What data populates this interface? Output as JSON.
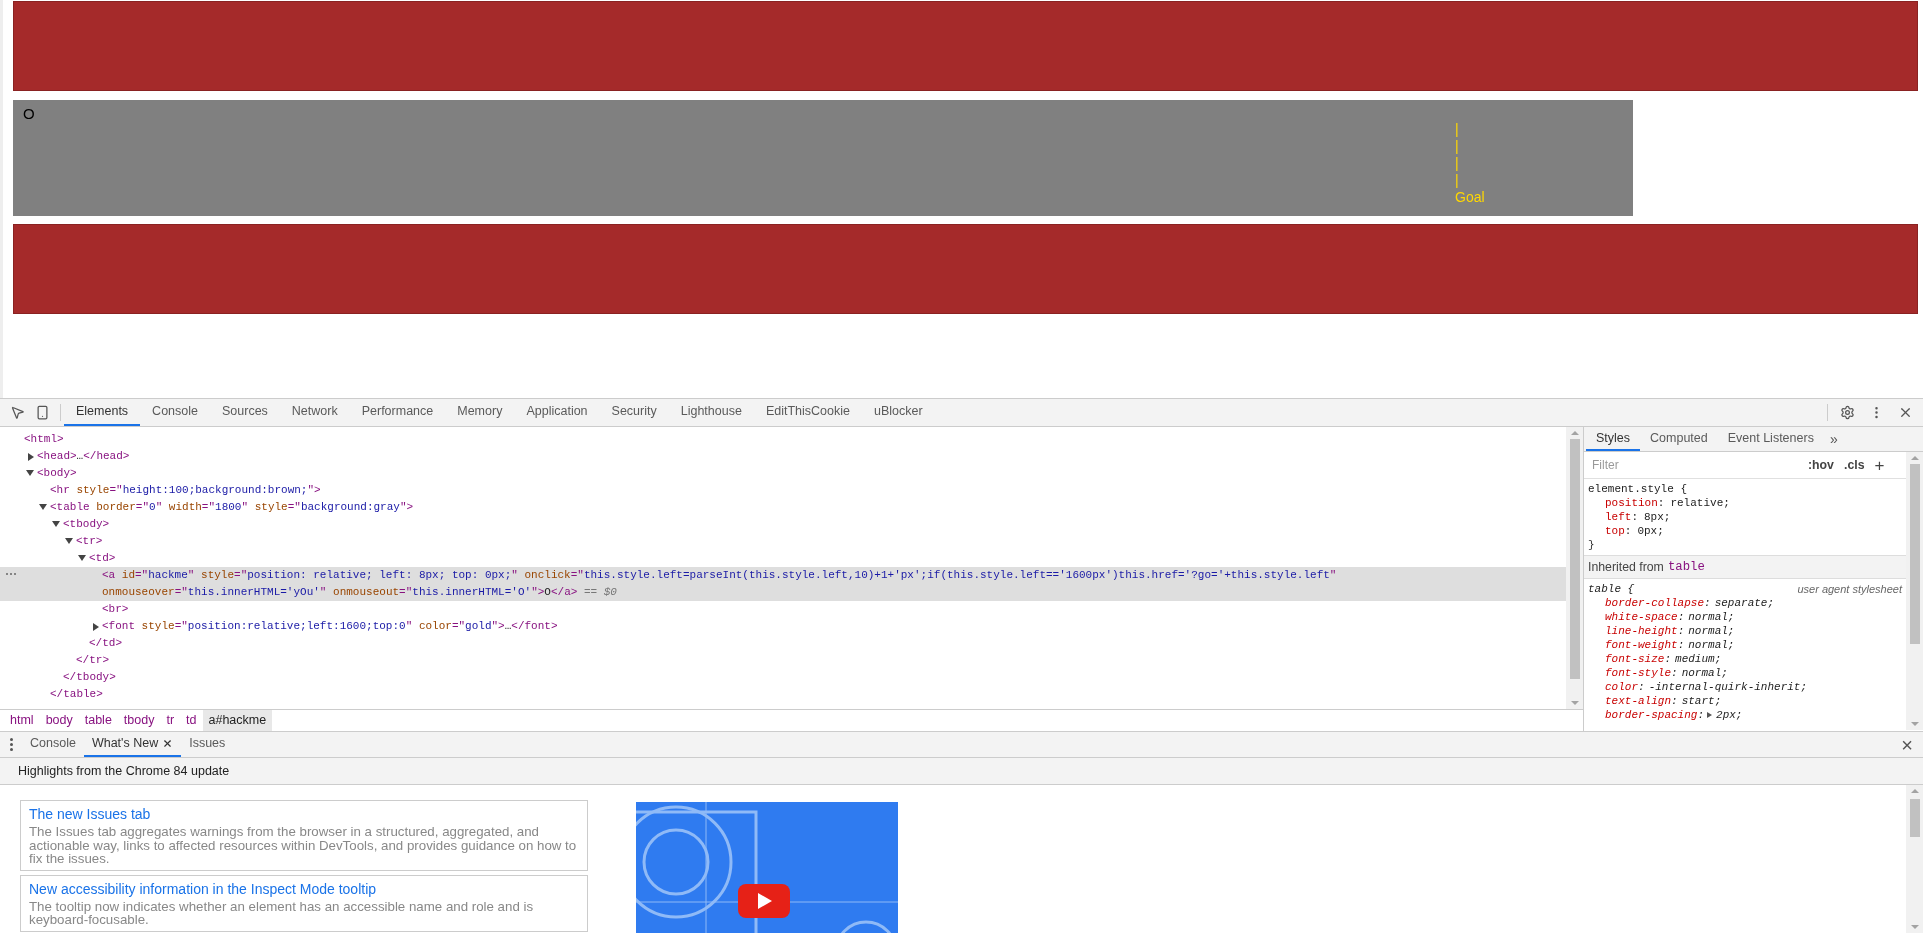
{
  "page": {
    "link_text": "O",
    "goal_lines": [
      "|",
      "|",
      "|",
      "|",
      "Goal"
    ]
  },
  "devtools": {
    "tabs": [
      {
        "label": "Elements",
        "selected": true
      },
      {
        "label": "Console",
        "selected": false
      },
      {
        "label": "Sources",
        "selected": false
      },
      {
        "label": "Network",
        "selected": false
      },
      {
        "label": "Performance",
        "selected": false
      },
      {
        "label": "Memory",
        "selected": false
      },
      {
        "label": "Application",
        "selected": false
      },
      {
        "label": "Security",
        "selected": false
      },
      {
        "label": "Lighthouse",
        "selected": false
      },
      {
        "label": "EditThisCookie",
        "selected": false
      },
      {
        "label": "uBlocker",
        "selected": false
      }
    ],
    "dom_tree": [
      {
        "selected": false,
        "tokens": [
          {
            "kind": "tag",
            "text": "<html>"
          }
        ],
        "children": [
          {
            "expanded": false,
            "selected": false,
            "tokens": [
              {
                "kind": "tag",
                "text": "<head>"
              },
              {
                "kind": "text",
                "text": "…"
              },
              {
                "kind": "tag",
                "text": "</head>"
              }
            ]
          },
          {
            "expanded": true,
            "selected": false,
            "tokens": [
              {
                "kind": "tag",
                "text": "<body>"
              }
            ],
            "children": [
              {
                "selected": false,
                "tokens": [
                  {
                    "kind": "tag",
                    "text": "<hr"
                  },
                  {
                    "kind": "attr",
                    "text": " style"
                  },
                  {
                    "kind": "tag",
                    "text": "=\""
                  },
                  {
                    "kind": "value",
                    "text": "height:100;background:brown;"
                  },
                  {
                    "kind": "tag",
                    "text": "\">"
                  }
                ]
              },
              {
                "expanded": true,
                "selected": false,
                "tokens": [
                  {
                    "kind": "tag",
                    "text": "<table"
                  },
                  {
                    "kind": "attr",
                    "text": " border"
                  },
                  {
                    "kind": "tag",
                    "text": "=\""
                  },
                  {
                    "kind": "value",
                    "text": "0"
                  },
                  {
                    "kind": "tag",
                    "text": "\""
                  },
                  {
                    "kind": "attr",
                    "text": " width"
                  },
                  {
                    "kind": "tag",
                    "text": "=\""
                  },
                  {
                    "kind": "value",
                    "text": "1800"
                  },
                  {
                    "kind": "tag",
                    "text": "\""
                  },
                  {
                    "kind": "attr",
                    "text": " style"
                  },
                  {
                    "kind": "tag",
                    "text": "=\""
                  },
                  {
                    "kind": "value",
                    "text": "background:gray"
                  },
                  {
                    "kind": "tag",
                    "text": "\">"
                  }
                ],
                "close": "</table>",
                "children": [
                  {
                    "expanded": true,
                    "selected": false,
                    "tokens": [
                      {
                        "kind": "tag",
                        "text": "<tbody>"
                      }
                    ],
                    "close": "</tbody>",
                    "children": [
                      {
                        "expanded": true,
                        "selected": false,
                        "tokens": [
                          {
                            "kind": "tag",
                            "text": "<tr>"
                          }
                        ],
                        "close": "</tr>",
                        "children": [
                          {
                            "expanded": true,
                            "selected": false,
                            "tokens": [
                              {
                                "kind": "tag",
                                "text": "<td>"
                              }
                            ],
                            "close": "</td>",
                            "children": [
                              {
                                "selected": true,
                                "tokens": [
                                  {
                                    "kind": "tag",
                                    "text": "<a"
                                  },
                                  {
                                    "kind": "attr",
                                    "text": " id"
                                  },
                                  {
                                    "kind": "tag",
                                    "text": "=\""
                                  },
                                  {
                                    "kind": "value",
                                    "text": "hackme"
                                  },
                                  {
                                    "kind": "tag",
                                    "text": "\""
                                  },
                                  {
                                    "kind": "attr",
                                    "text": " style"
                                  },
                                  {
                                    "kind": "tag",
                                    "text": "=\""
                                  },
                                  {
                                    "kind": "value",
                                    "text": "position: relative; left: 8px; top: 0px;"
                                  },
                                  {
                                    "kind": "tag",
                                    "text": "\""
                                  },
                                  {
                                    "kind": "attr",
                                    "text": " onclick"
                                  },
                                  {
                                    "kind": "tag",
                                    "text": "=\""
                                  },
                                  {
                                    "kind": "value",
                                    "text": "this.style.left=parseInt(this.style.left,10)+1+'px';if(this.style.left=='1600px')this.href='?go='+this.style.left"
                                  },
                                  {
                                    "kind": "tag",
                                    "text": "\""
                                  },
                                  {
                                    "kind": "attr",
                                    "text": " onmouseover"
                                  },
                                  {
                                    "kind": "tag",
                                    "text": "=\""
                                  },
                                  {
                                    "kind": "value",
                                    "text": "this.innerHTML='yOu'"
                                  },
                                  {
                                    "kind": "tag",
                                    "text": "\""
                                  },
                                  {
                                    "kind": "attr",
                                    "text": " onmouseout"
                                  },
                                  {
                                    "kind": "tag",
                                    "text": "=\""
                                  },
                                  {
                                    "kind": "value",
                                    "text": "this.innerHTML='O'"
                                  },
                                  {
                                    "kind": "tag",
                                    "text": "\">"
                                  },
                                  {
                                    "kind": "text",
                                    "text": "O"
                                  },
                                  {
                                    "kind": "tag",
                                    "text": "</a>"
                                  },
                                  {
                                    "kind": "marker",
                                    "text": " == $0"
                                  }
                                ]
                              },
                              {
                                "selected": false,
                                "tokens": [
                                  {
                                    "kind": "tag",
                                    "text": "<br>"
                                  }
                                ]
                              },
                              {
                                "expanded": false,
                                "selected": false,
                                "tokens": [
                                  {
                                    "kind": "tag",
                                    "text": "<font"
                                  },
                                  {
                                    "kind": "attr",
                                    "text": " style"
                                  },
                                  {
                                    "kind": "tag",
                                    "text": "=\""
                                  },
                                  {
                                    "kind": "value",
                                    "text": "position:relative;left:1600;top:0"
                                  },
                                  {
                                    "kind": "tag",
                                    "text": "\""
                                  },
                                  {
                                    "kind": "attr",
                                    "text": " color"
                                  },
                                  {
                                    "kind": "tag",
                                    "text": "=\""
                                  },
                                  {
                                    "kind": "value",
                                    "text": "gold"
                                  },
                                  {
                                    "kind": "tag",
                                    "text": "\">"
                                  },
                                  {
                                    "kind": "text",
                                    "text": "…"
                                  },
                                  {
                                    "kind": "tag",
                                    "text": "</font>"
                                  }
                                ]
                              }
                            ]
                          }
                        ]
                      }
                    ]
                  }
                ]
              }
            ]
          }
        ]
      }
    ],
    "breadcrumbs": [
      {
        "label": "html",
        "selected": false
      },
      {
        "label": "body",
        "selected": false
      },
      {
        "label": "table",
        "selected": false
      },
      {
        "label": "tbody",
        "selected": false
      },
      {
        "label": "tr",
        "selected": false
      },
      {
        "label": "td",
        "selected": false
      },
      {
        "label": "a#hackme",
        "selected": true
      }
    ],
    "styles": {
      "tabs": [
        {
          "label": "Styles",
          "selected": true
        },
        {
          "label": "Computed",
          "selected": false
        },
        {
          "label": "Event Listeners",
          "selected": false
        }
      ],
      "more": "»",
      "filter_placeholder": "Filter",
      "hov": ":hov",
      "cls": ".cls",
      "add": "+",
      "element_style": {
        "selector": "element.style {",
        "props": [
          {
            "name": "position",
            "sep": ":",
            "value": "relative;"
          },
          {
            "name": "left",
            "sep": ":",
            "value": "8px;"
          },
          {
            "name": "top",
            "sep": ":",
            "value": "0px;"
          }
        ],
        "close": "}"
      },
      "inherited_label": "Inherited from",
      "inherited_tag": "table",
      "ua_rule": {
        "selector": "table {",
        "source": "user agent stylesheet",
        "props": [
          {
            "name": "border-collapse",
            "sep": ":",
            "value": "separate;",
            "expandable": false
          },
          {
            "name": "white-space",
            "sep": ":",
            "value": "normal;",
            "expandable": false
          },
          {
            "name": "line-height",
            "sep": ":",
            "value": "normal;",
            "expandable": false
          },
          {
            "name": "font-weight",
            "sep": ":",
            "value": "normal;",
            "expandable": false
          },
          {
            "name": "font-size",
            "sep": ":",
            "value": "medium;",
            "expandable": false
          },
          {
            "name": "font-style",
            "sep": ":",
            "value": "normal;",
            "expandable": false
          },
          {
            "name": "color",
            "sep": ":",
            "value": "-internal-quirk-inherit;",
            "expandable": false
          },
          {
            "name": "text-align",
            "sep": ":",
            "value": "start;",
            "expandable": false
          },
          {
            "name": "border-spacing",
            "sep": ":",
            "value": "2px;",
            "expandable": true
          }
        ]
      }
    },
    "drawer": {
      "tabs": [
        {
          "label": "Console",
          "selected": false,
          "closable": false
        },
        {
          "label": "What's New",
          "selected": true,
          "closable": true
        },
        {
          "label": "Issues",
          "selected": false,
          "closable": false
        }
      ],
      "close": "×",
      "header": "Highlights from the Chrome 84 update",
      "cards": [
        {
          "title": "The new Issues tab",
          "text": "The Issues tab aggregates warnings from the browser in a structured, aggregated, and actionable way, links to affected resources within DevTools, and provides guidance on how to fix the issues."
        },
        {
          "title": "New accessibility information in the Inspect Mode tooltip",
          "text": "The tooltip now indicates whether an element has an accessible name and role and is keyboard-focusable."
        }
      ]
    }
  }
}
